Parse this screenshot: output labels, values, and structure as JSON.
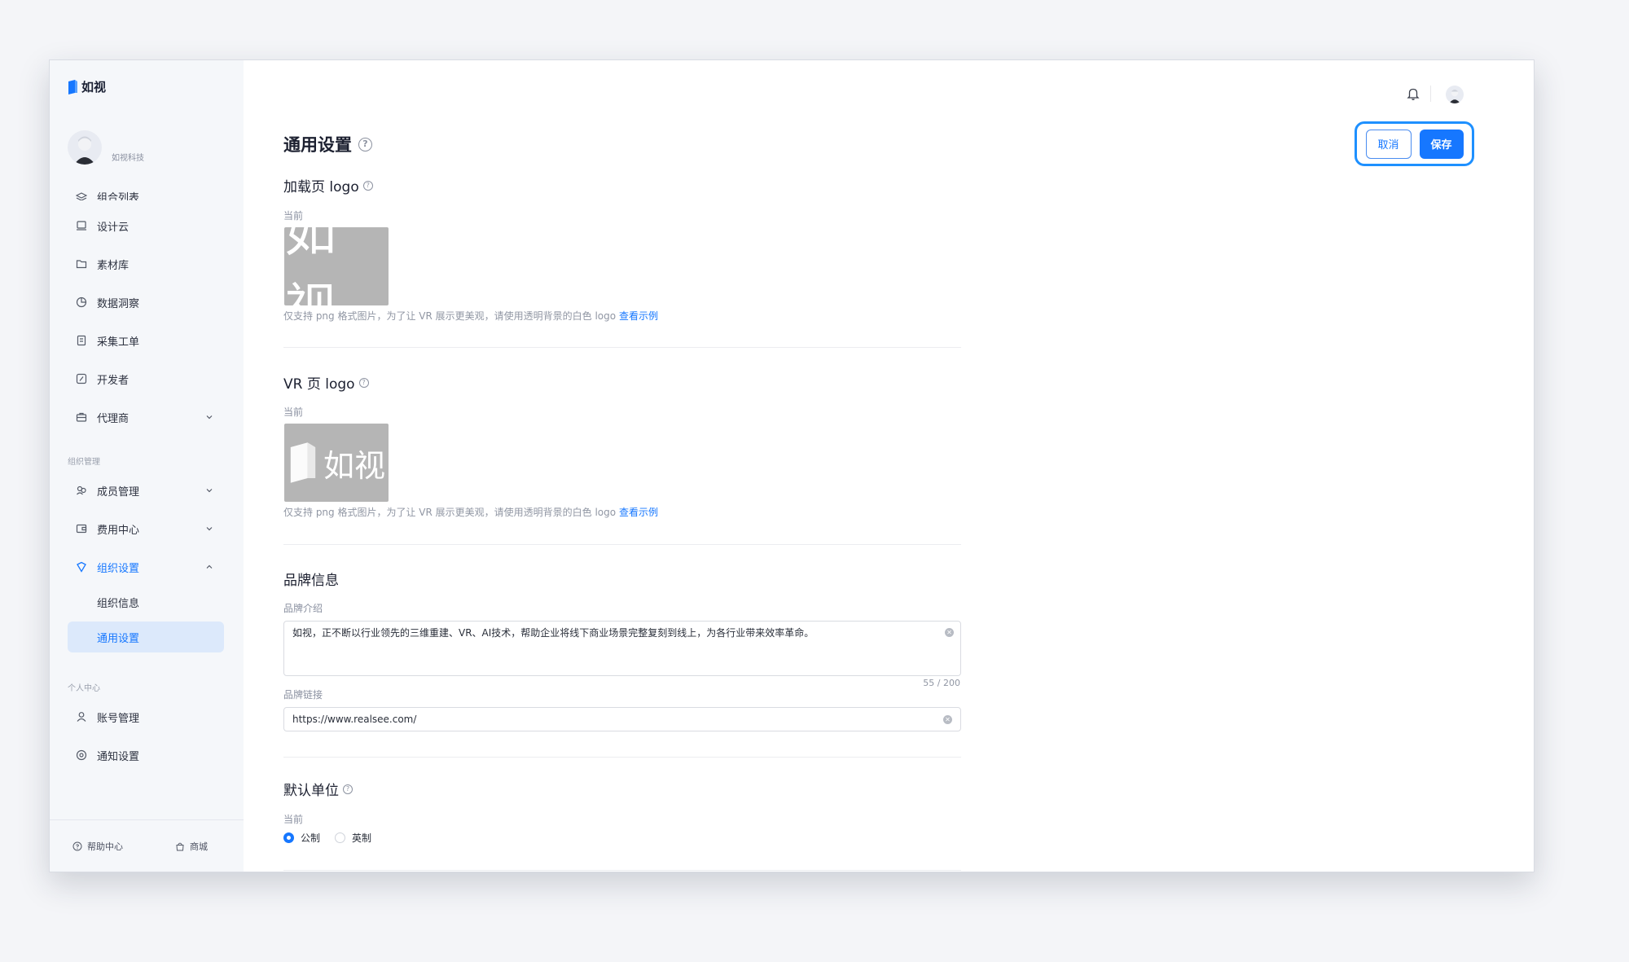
{
  "colors": {
    "accent": "#1677ff",
    "sidebar_bg": "#f5f7fa",
    "selected_bg": "#dce9fb",
    "logo_bg": "#b5b5b5"
  },
  "brand": {
    "name": "如视",
    "logo_icon": "realsee-logo-icon"
  },
  "profile": {
    "org_name": "如视科技",
    "avatar": "user-avatar"
  },
  "sidebar": {
    "items": [
      {
        "label": "组合列表",
        "icon": "layers-icon"
      },
      {
        "label": "设计云",
        "icon": "monitor-icon"
      },
      {
        "label": "素材库",
        "icon": "folder-icon"
      },
      {
        "label": "数据洞察",
        "icon": "pie-chart-icon"
      },
      {
        "label": "采集工单",
        "icon": "clipboard-icon"
      },
      {
        "label": "开发者",
        "icon": "code-icon"
      },
      {
        "label": "代理商",
        "icon": "briefcase-icon"
      }
    ],
    "org_group": "组织管理",
    "org_items": [
      {
        "label": "成员管理",
        "icon": "members-icon"
      },
      {
        "label": "费用中心",
        "icon": "wallet-icon"
      },
      {
        "label": "组织设置",
        "icon": "shield-icon"
      }
    ],
    "org_sub_items": [
      {
        "label": "组织信息"
      },
      {
        "label": "通用设置"
      }
    ],
    "personal_group": "个人中心",
    "personal_items": [
      {
        "label": "账号管理",
        "icon": "user-icon"
      },
      {
        "label": "通知设置",
        "icon": "settings-icon"
      }
    ],
    "footer": {
      "help": "帮助中心",
      "store": "商城"
    }
  },
  "page": {
    "title": "通用设置",
    "cancel_label": "取消",
    "save_label": "保存",
    "loading_logo": {
      "title": "加载页 logo",
      "current_label": "当前",
      "logo_text": "如视",
      "hint": "仅支持 png 格式图片，为了让 VR 展示更美观，请使用透明背景的白色 logo",
      "example_link": "查看示例"
    },
    "vr_logo": {
      "title": "VR 页 logo",
      "current_label": "当前",
      "logo_text": "如视",
      "hint": "仅支持 png 格式图片，为了让 VR 展示更美观，请使用透明背景的白色 logo",
      "example_link": "查看示例"
    },
    "brand_info": {
      "title": "品牌信息",
      "intro_label": "品牌介绍",
      "intro_value": "如视，正不断以行业领先的三维重建、VR、AI技术，帮助企业将线下商业场景完整复刻到线上，为各行业带来效率革命。",
      "intro_counter": "55 / 200",
      "link_label": "品牌链接",
      "link_value": "https://www.realsee.com/"
    },
    "default_unit": {
      "title": "默认单位",
      "current_label": "当前",
      "options": [
        "公制",
        "英制"
      ],
      "selected": "公制"
    }
  }
}
